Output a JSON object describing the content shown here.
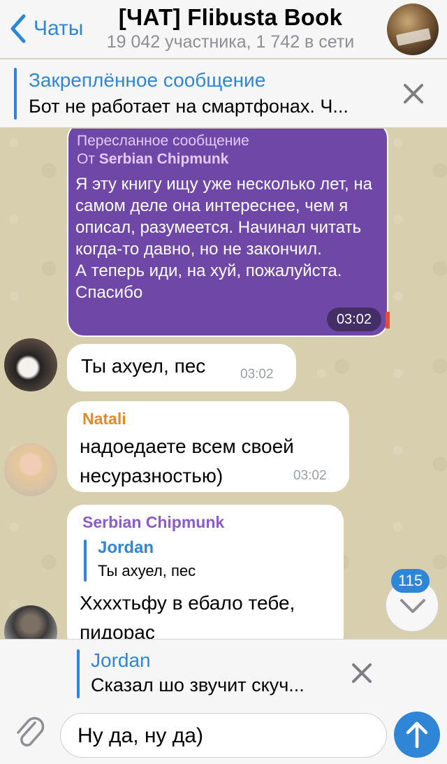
{
  "header": {
    "back_label": "Чаты",
    "title": "[ЧАТ] Flibusta Book",
    "subtitle": "19 042 участника, 1 742 в сети"
  },
  "pinned": {
    "title": "Закреплённое сообщение",
    "text": "Бот не работает на смартфонах. Ч..."
  },
  "messages": {
    "forwarded": {
      "label": "Пересланное сообщение",
      "from_prefix": "От",
      "from_name": "Serbian Chipmunk",
      "text": "Я эту книгу ищу уже несколько лет, на самом деле она интереснее, чем я описал, разумеется. Начинал читать когда-то давно, но не закончил.\nА теперь иди, на хуй, пожалуйста. Спасибо",
      "time": "03:02"
    },
    "m1": {
      "text": "Ты ахуел, пес",
      "time": "03:02"
    },
    "m2": {
      "author": "Natali",
      "text": "надоедаете всем своей несуразностью)",
      "time": "03:02"
    },
    "m3": {
      "author": "Serbian Chipmunk",
      "reply_name": "Jordan",
      "reply_text": "Ты ахуел, пес",
      "text": "Хххxтьфу в ебало тебе, пидорас"
    }
  },
  "unread_badge": "115",
  "reply_preview": {
    "name": "Jordan",
    "text": "Сказал шо звучит скуч..."
  },
  "input": {
    "value": "Ну да, ну да)"
  },
  "colors": {
    "accent": "#2f86d6",
    "forwarded_bg": "#6f47a6",
    "natali": "#e08a2e",
    "chipmunk": "#8b5bc9"
  }
}
